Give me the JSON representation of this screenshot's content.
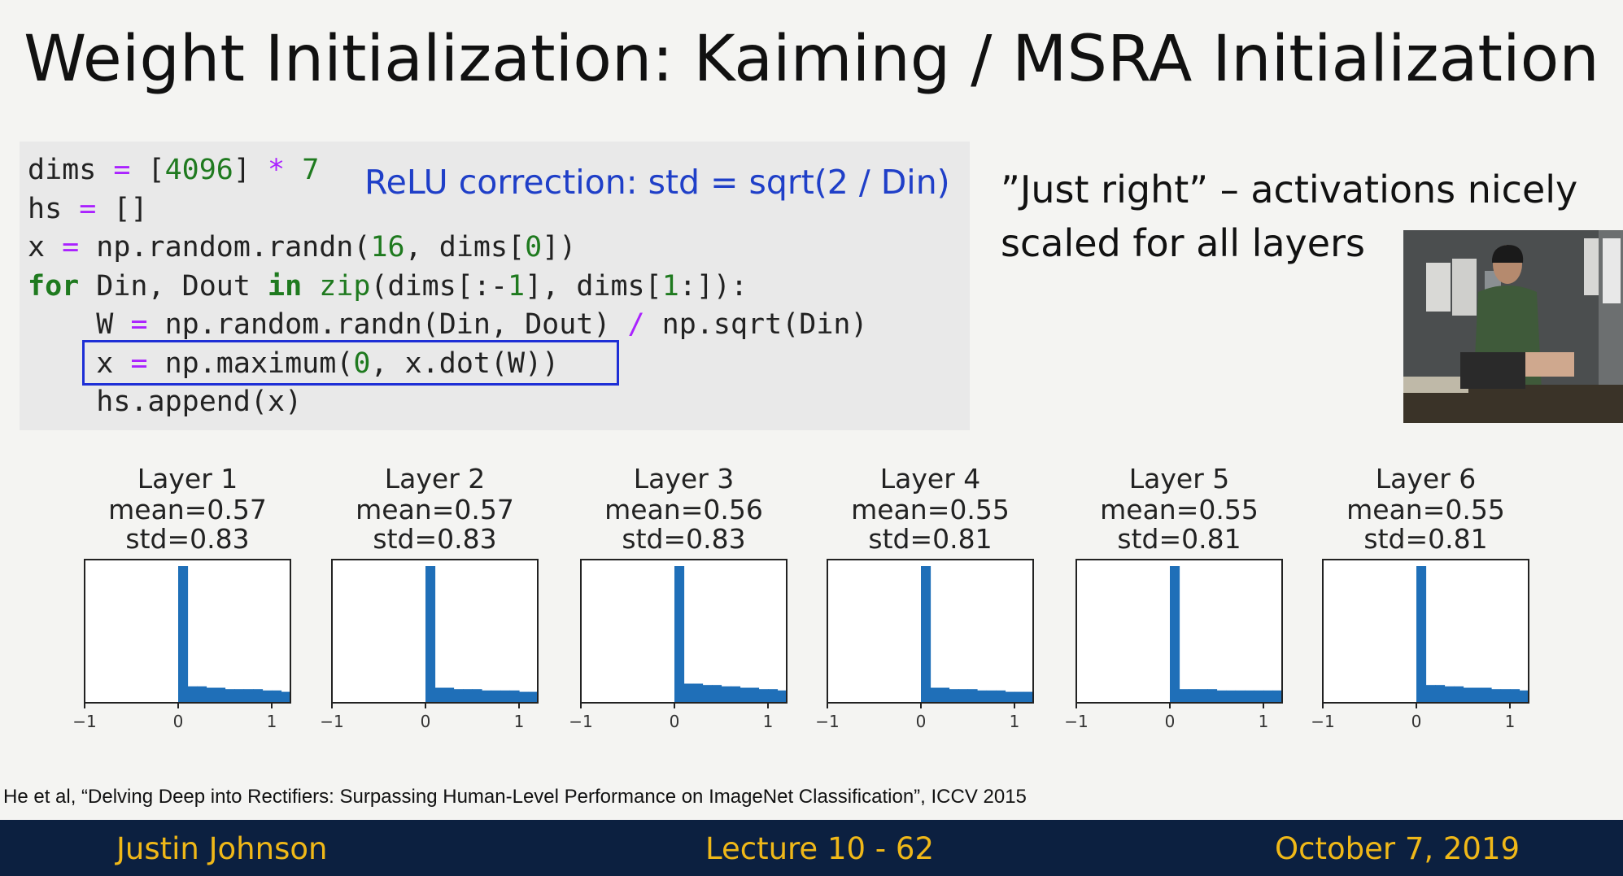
{
  "slide": {
    "title": "Weight Initialization: Kaiming / MSRA Initialization",
    "code_lines": [
      "dims = [4096] * 7",
      "hs = []",
      "x = np.random.randn(16, dims[0])",
      "for Din, Dout in zip(dims[:-1], dims[1:]):",
      "    W = np.random.randn(Din, Dout) / np.sqrt(Din)",
      "    x = np.maximum(0, x.dot(W))",
      "    hs.append(x)"
    ],
    "relu_note": "ReLU correction: std = sqrt(2 / Din)",
    "right_note": "”Just right” – activations nicely scaled for all layers",
    "citation": "He et al, “Delving Deep into Rectifiers: Surpassing Human-Level Performance on ImageNet Classification”, ICCV 2015"
  },
  "footer": {
    "left": "Justin Johnson",
    "center": "Lecture 10 - 62",
    "right": "October 7, 2019"
  },
  "colors": {
    "bar": "#1f6fb8",
    "footer_bg": "#0c2040",
    "footer_text": "#f0b818",
    "relu_note": "#1f3fc8"
  },
  "chart_data": [
    {
      "type": "bar",
      "title": "Layer 1",
      "stats": [
        "mean=0.57",
        "std=0.83"
      ],
      "xlim": [
        -1,
        1.2
      ],
      "xticks": [
        "−1",
        "0",
        "1"
      ],
      "bins": [
        0,
        0.1,
        0.2,
        0.3,
        0.4,
        0.5,
        0.6,
        0.7,
        0.8,
        0.9,
        1.0,
        1.1,
        1.2
      ],
      "values": [
        1.0,
        0.12,
        0.12,
        0.11,
        0.11,
        0.1,
        0.1,
        0.1,
        0.1,
        0.09,
        0.09,
        0.08
      ]
    },
    {
      "type": "bar",
      "title": "Layer 2",
      "stats": [
        "mean=0.57",
        "std=0.83"
      ],
      "xlim": [
        -1,
        1.2
      ],
      "xticks": [
        "−1",
        "0",
        "1"
      ],
      "bins": [
        0,
        0.1,
        0.2,
        0.3,
        0.4,
        0.5,
        0.6,
        0.7,
        0.8,
        0.9,
        1.0,
        1.1,
        1.2
      ],
      "values": [
        1.0,
        0.11,
        0.11,
        0.1,
        0.1,
        0.1,
        0.09,
        0.09,
        0.09,
        0.09,
        0.08,
        0.08
      ]
    },
    {
      "type": "bar",
      "title": "Layer 3",
      "stats": [
        "mean=0.56",
        "std=0.83"
      ],
      "xlim": [
        -1,
        1.2
      ],
      "xticks": [
        "−1",
        "0",
        "1"
      ],
      "bins": [
        0,
        0.1,
        0.2,
        0.3,
        0.4,
        0.5,
        0.6,
        0.7,
        0.8,
        0.9,
        1.0,
        1.1,
        1.2
      ],
      "values": [
        1.0,
        0.14,
        0.14,
        0.13,
        0.13,
        0.12,
        0.12,
        0.11,
        0.11,
        0.1,
        0.1,
        0.09
      ]
    },
    {
      "type": "bar",
      "title": "Layer 4",
      "stats": [
        "mean=0.55",
        "std=0.81"
      ],
      "xlim": [
        -1,
        1.2
      ],
      "xticks": [
        "−1",
        "0",
        "1"
      ],
      "bins": [
        0,
        0.1,
        0.2,
        0.3,
        0.4,
        0.5,
        0.6,
        0.7,
        0.8,
        0.9,
        1.0,
        1.1,
        1.2
      ],
      "values": [
        1.0,
        0.11,
        0.11,
        0.1,
        0.1,
        0.1,
        0.09,
        0.09,
        0.09,
        0.08,
        0.08,
        0.08
      ]
    },
    {
      "type": "bar",
      "title": "Layer 5",
      "stats": [
        "mean=0.55",
        "std=0.81"
      ],
      "xlim": [
        -1,
        1.2
      ],
      "xticks": [
        "−1",
        "0",
        "1"
      ],
      "bins": [
        0,
        0.1,
        0.2,
        0.3,
        0.4,
        0.5,
        0.6,
        0.7,
        0.8,
        0.9,
        1.0,
        1.1,
        1.2
      ],
      "values": [
        1.0,
        0.1,
        0.1,
        0.1,
        0.1,
        0.09,
        0.09,
        0.09,
        0.09,
        0.09,
        0.09,
        0.09
      ]
    },
    {
      "type": "bar",
      "title": "Layer 6",
      "stats": [
        "mean=0.55",
        "std=0.81"
      ],
      "xlim": [
        -1,
        1.2
      ],
      "xticks": [
        "−1",
        "0",
        "1"
      ],
      "bins": [
        0,
        0.1,
        0.2,
        0.3,
        0.4,
        0.5,
        0.6,
        0.7,
        0.8,
        0.9,
        1.0,
        1.1,
        1.2
      ],
      "values": [
        1.0,
        0.13,
        0.13,
        0.12,
        0.12,
        0.11,
        0.11,
        0.11,
        0.1,
        0.1,
        0.1,
        0.09
      ]
    }
  ]
}
